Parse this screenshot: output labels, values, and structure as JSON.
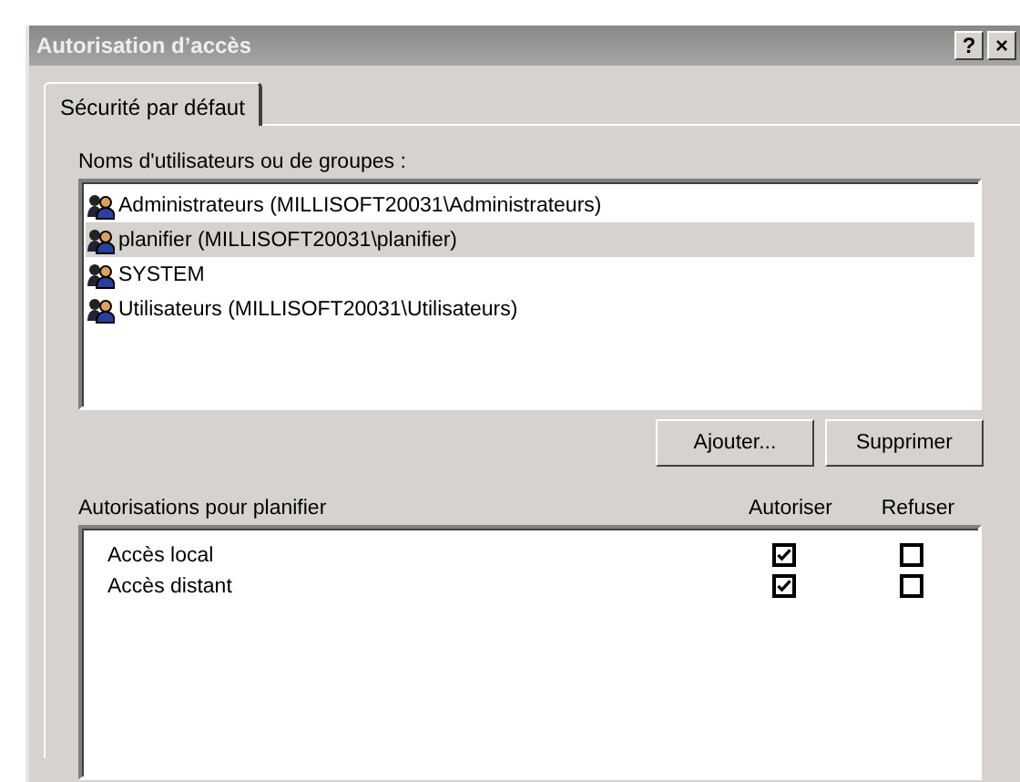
{
  "window": {
    "title": "Autorisation d’accès",
    "buttons": [
      "?",
      "×"
    ]
  },
  "tabs": [
    {
      "label": "Sécurité par défaut",
      "selected": true
    }
  ],
  "users": {
    "label": "Noms d'utilisateurs ou de groupes :",
    "items": [
      {
        "name": "Administrateurs (MILLISOFT20031\\Administrateurs)",
        "selected": false
      },
      {
        "name": "planifier (MILLISOFT20031\\planifier)",
        "selected": true
      },
      {
        "name": "SYSTEM",
        "selected": false
      },
      {
        "name": "Utilisateurs (MILLISOFT20031\\Utilisateurs)",
        "selected": false
      }
    ]
  },
  "user_buttons": [
    "Ajouter...",
    "Supprimer"
  ],
  "permissions": {
    "label": "Autorisations pour planifier",
    "columns": [
      "Autoriser",
      "Refuser"
    ],
    "rows": [
      {
        "name": "Accès local",
        "allow": true,
        "deny": false
      },
      {
        "name": "Accès distant",
        "allow": true,
        "deny": false
      }
    ]
  }
}
